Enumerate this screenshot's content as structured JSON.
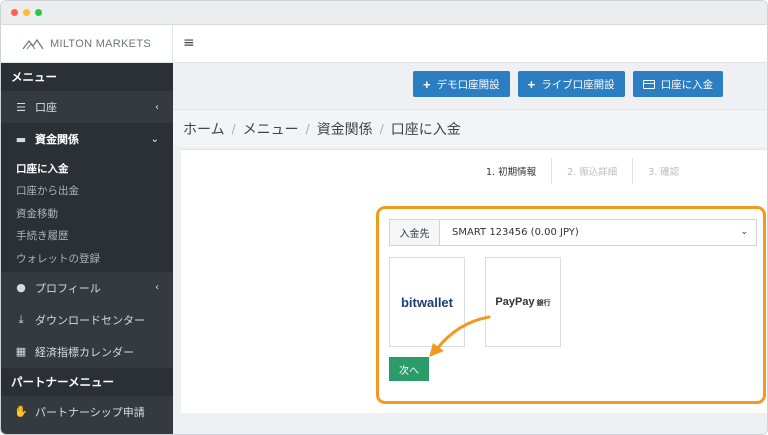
{
  "brand": {
    "name": "MILTON MARKETS"
  },
  "sidebar": {
    "section_menu": "メニュー",
    "items": [
      {
        "label": "口座",
        "icon": "list-icon",
        "chevron": "‹"
      },
      {
        "label": "資金関係",
        "icon": "card-icon",
        "chevron": "⌄"
      }
    ],
    "sub_items": [
      "口座に入金",
      "口座から出金",
      "資金移動",
      "手続き履歴",
      "ウォレットの登録"
    ],
    "items2": [
      {
        "label": "プロフィール",
        "icon": "user-icon",
        "chevron": "‹"
      },
      {
        "label": "ダウンロードセンター",
        "icon": "download-icon"
      },
      {
        "label": "経済指標カレンダー",
        "icon": "calendar-icon"
      }
    ],
    "section_partner": "パートナーメニュー",
    "partner_item": {
      "label": "パートナーシップ申請",
      "icon": "handshake-icon"
    }
  },
  "topbar": {
    "menu_icon": "≡"
  },
  "buttons": {
    "demo": "デモ口座開設",
    "live": "ライブ口座開設",
    "deposit": "口座に入金"
  },
  "breadcrumb": [
    "ホーム",
    "メニュー",
    "資金関係",
    "口座に入金"
  ],
  "steps": [
    "1. 初期情報",
    "2. 振込詳細",
    "3. 確認"
  ],
  "form": {
    "dest_label": "入金先",
    "dest_value": "SMART 123456 (0.00 JPY)"
  },
  "payment": {
    "bitwallet": "bitwallet",
    "paypay": "PayPay",
    "paypay_bank": "銀行"
  },
  "next_button": "次へ",
  "colors": {
    "highlight": "#f29a1f",
    "primary": "#2a7ec1",
    "next": "#2d9a6a",
    "sidebar": "#343a40"
  }
}
